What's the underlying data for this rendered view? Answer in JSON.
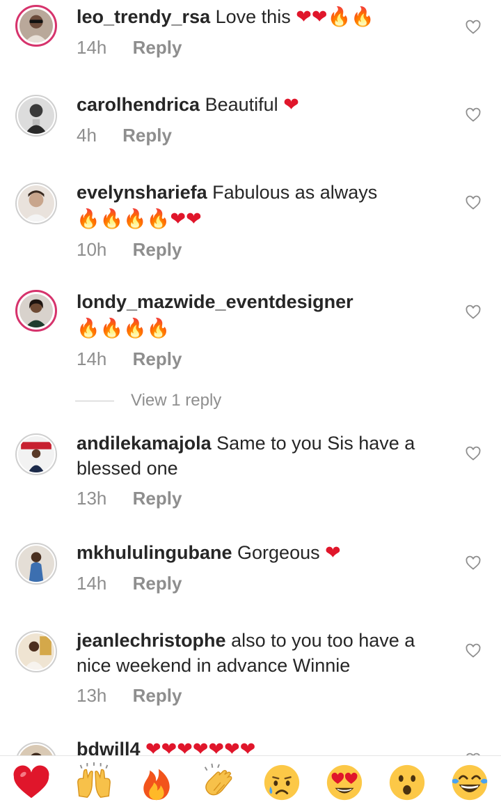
{
  "comments": [
    {
      "username": "leo_trendy_rsa",
      "text": "Love this",
      "time": "14h",
      "reply": "Reply"
    },
    {
      "username": "carolhendrica",
      "text": "Beautiful",
      "time": "4h",
      "reply": "Reply"
    },
    {
      "username": "evelynshariefa",
      "text": "Fabulous as always",
      "time": "10h",
      "reply": "Reply"
    },
    {
      "username": "londy_mazwide_eventdesigner",
      "text": "",
      "time": "14h",
      "reply": "Reply"
    },
    {
      "username": "andilekamajola",
      "text": "Same to you Sis have a blessed one",
      "time": "13h",
      "reply": "Reply"
    },
    {
      "username": "mkhululingubane",
      "text": "Gorgeous",
      "time": "14h",
      "reply": "Reply"
    },
    {
      "username": "jeanlechristophe",
      "text": "also to you too have a nice weekend in advance Winnie",
      "time": "13h",
      "reply": "Reply"
    },
    {
      "username": "bdwill4",
      "text": "",
      "time": "",
      "reply": ""
    }
  ],
  "view_replies": "View 1 reply",
  "emoji_reactions": [
    "red-heart",
    "raising-hands",
    "fire",
    "clapping-hands",
    "sad-face",
    "heart-eyes",
    "surprised-face",
    "tears-of-joy"
  ],
  "colors": {
    "text": "#262626",
    "meta": "#8e8e8e",
    "heart": "#e0162b",
    "fire": "#f08a1c",
    "story_ring": "#d6336c"
  },
  "icons": {
    "like": "heart-outline-icon"
  }
}
